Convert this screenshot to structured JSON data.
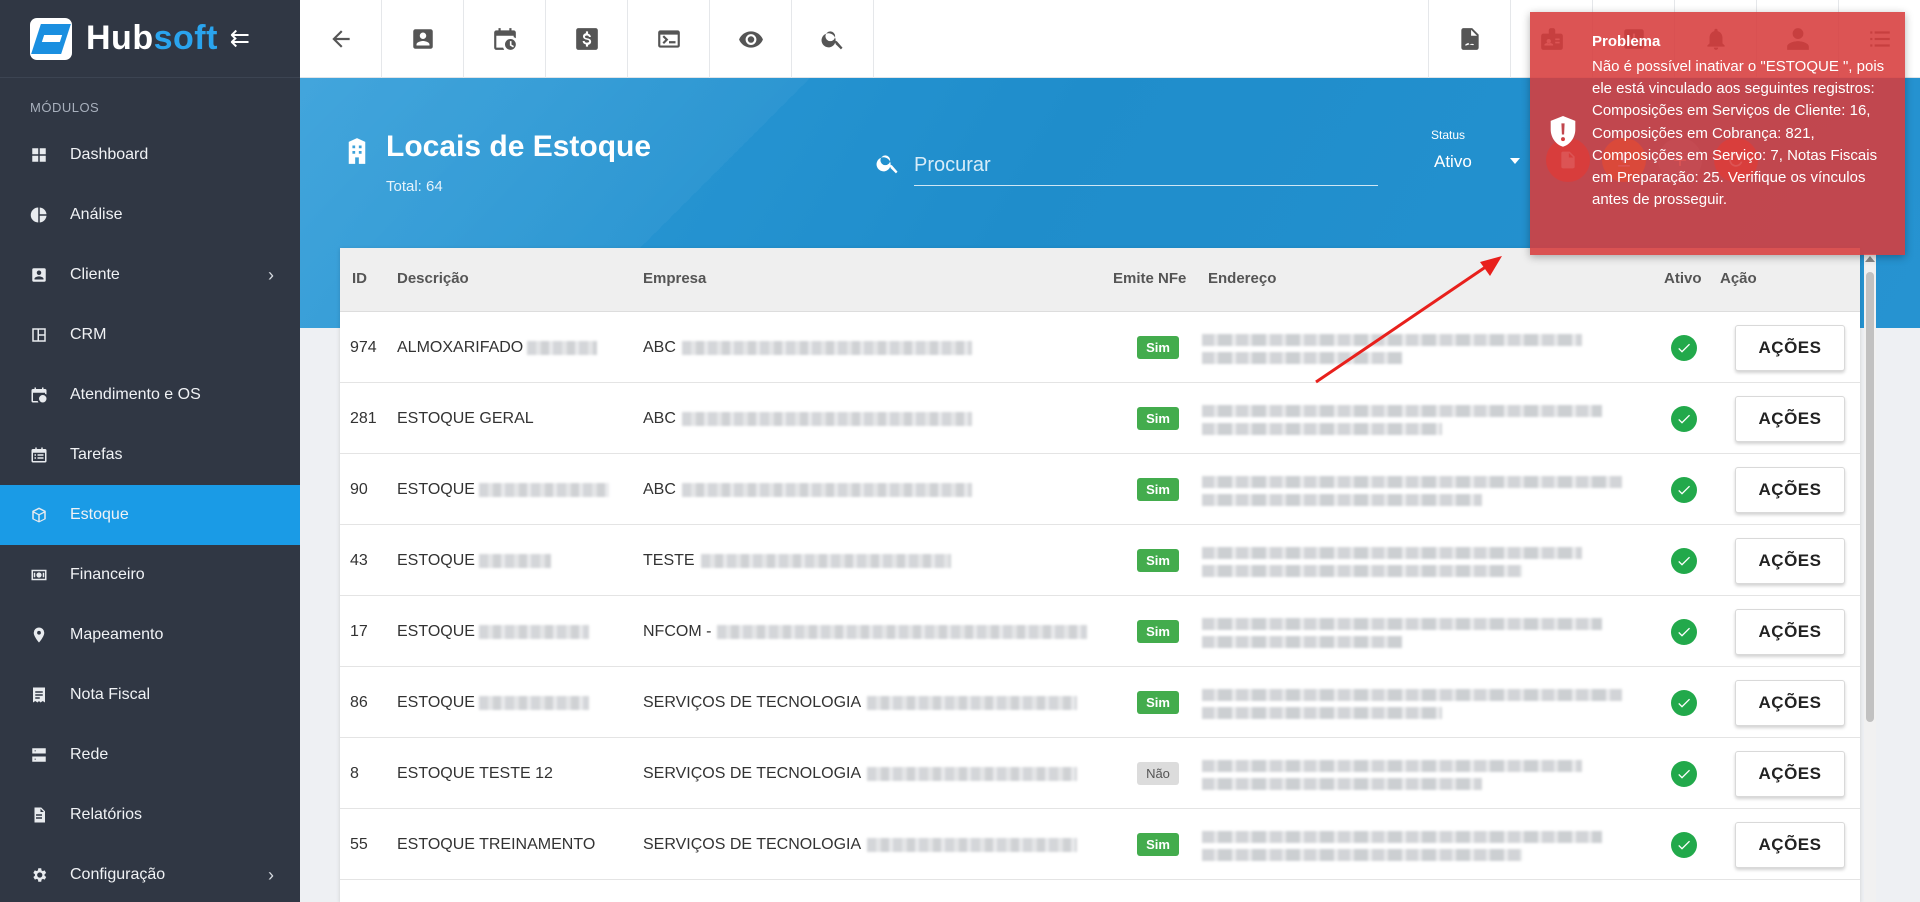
{
  "brand": {
    "name_hub": "Hub",
    "name_soft": "soft"
  },
  "sidebar": {
    "section_label": "MÓDULOS",
    "items": [
      {
        "label": "Dashboard",
        "icon": "dashboard-icon",
        "active": false,
        "has_chevron": false
      },
      {
        "label": "Análise",
        "icon": "pie-chart-icon",
        "active": false,
        "has_chevron": false
      },
      {
        "label": "Cliente",
        "icon": "contact-card-icon",
        "active": false,
        "has_chevron": true
      },
      {
        "label": "CRM",
        "icon": "crm-board-icon",
        "active": false,
        "has_chevron": false
      },
      {
        "label": "Atendimento e OS",
        "icon": "calendar-clock-icon",
        "active": false,
        "has_chevron": false
      },
      {
        "label": "Tarefas",
        "icon": "tasks-icon",
        "active": false,
        "has_chevron": false
      },
      {
        "label": "Estoque",
        "icon": "box-icon",
        "active": true,
        "has_chevron": false
      },
      {
        "label": "Financeiro",
        "icon": "money-icon",
        "active": false,
        "has_chevron": false
      },
      {
        "label": "Mapeamento",
        "icon": "map-pin-icon",
        "active": false,
        "has_chevron": false
      },
      {
        "label": "Nota Fiscal",
        "icon": "invoice-icon",
        "active": false,
        "has_chevron": false
      },
      {
        "label": "Rede",
        "icon": "server-icon",
        "active": false,
        "has_chevron": false
      },
      {
        "label": "Relatórios",
        "icon": "report-icon",
        "active": false,
        "has_chevron": false
      },
      {
        "label": "Configuração",
        "icon": "gear-icon",
        "active": false,
        "has_chevron": true
      }
    ]
  },
  "header": {
    "title": "Locais de Estoque",
    "total": "Total: 64",
    "search_placeholder": "Procurar",
    "status_label": "Status",
    "status_value": "Ativo"
  },
  "table": {
    "columns": [
      "ID",
      "Descrição",
      "Empresa",
      "Emite NFe",
      "Endereço",
      "Ativo",
      "Ação"
    ],
    "rows": [
      {
        "id": "974",
        "descricao": "ALMOXARIFADO",
        "empresa": "ABC",
        "emite_nfe": "Sim",
        "ativo": true,
        "acao": "AÇÕES"
      },
      {
        "id": "281",
        "descricao": "ESTOQUE GERAL",
        "empresa": "ABC",
        "emite_nfe": "Sim",
        "ativo": true,
        "acao": "AÇÕES"
      },
      {
        "id": "90",
        "descricao": "ESTOQUE",
        "empresa": "ABC",
        "emite_nfe": "Sim",
        "ativo": true,
        "acao": "AÇÕES"
      },
      {
        "id": "43",
        "descricao": "ESTOQUE",
        "empresa": "TESTE",
        "emite_nfe": "Sim",
        "ativo": true,
        "acao": "AÇÕES"
      },
      {
        "id": "17",
        "descricao": "ESTOQUE",
        "empresa": "NFCOM -",
        "emite_nfe": "Sim",
        "ativo": true,
        "acao": "AÇÕES"
      },
      {
        "id": "86",
        "descricao": "ESTOQUE",
        "empresa": "SERVIÇOS DE TECNOLOGIA",
        "emite_nfe": "Sim",
        "ativo": true,
        "acao": "AÇÕES"
      },
      {
        "id": "8",
        "descricao": "ESTOQUE TESTE 12",
        "empresa": "SERVIÇOS DE TECNOLOGIA",
        "emite_nfe": "Não",
        "ativo": true,
        "acao": "AÇÕES"
      },
      {
        "id": "55",
        "descricao": "ESTOQUE TREINAMENTO",
        "empresa": "SERVIÇOS DE TECNOLOGIA",
        "emite_nfe": "Sim",
        "ativo": true,
        "acao": "AÇÕES"
      }
    ]
  },
  "toast": {
    "title": "Problema",
    "message": "Não é possível inativar o \"ESTOQUE \", pois ele está vinculado aos seguintes registros: Composições em Serviços de Cliente: 16, Composições em Cobrança: 821, Composições em Serviço: 7, Notas Fiscais em Preparação: 25. Verifique os vínculos antes de prosseguir."
  },
  "colors": {
    "sidebar_bg": "#303744",
    "active_item": "#1a9be6",
    "header_band": "#1f8dcb",
    "badge_sim": "#43ac4d",
    "check_green": "#22a94b",
    "toast_red": "#d73c3c",
    "annotation_arrow": "#e8201c"
  }
}
